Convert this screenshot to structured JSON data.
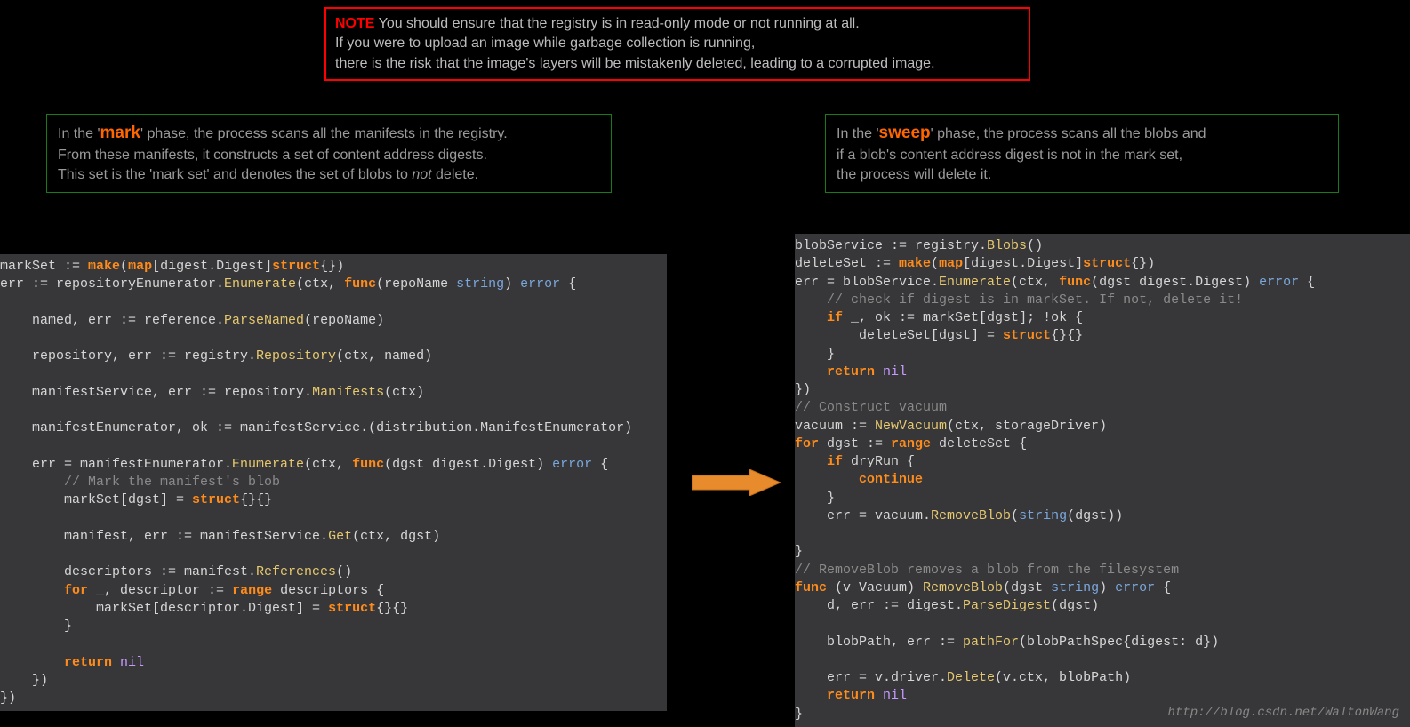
{
  "note": {
    "label": "NOTE",
    "line1_rest": " You should ensure that the registry is in read-only mode or not running at all.",
    "line2": "If you were to upload an image while garbage collection is running,",
    "line3": "there is the risk that the image's layers will be mistakenly deleted, leading to a corrupted image."
  },
  "mark_phase": {
    "pre": "In the '",
    "word": "mark",
    "post": "' phase, the process scans all the manifests in the registry.",
    "line2": "From these manifests, it constructs a set of content address digests.",
    "line3a": "This set is the 'mark set' and denotes the set of blobs to ",
    "line3_not": "not",
    "line3b": " delete."
  },
  "sweep_phase": {
    "pre": "In the '",
    "word": "sweep",
    "post": "' phase, the process scans all the blobs and",
    "line2": "if a blob's content address digest is not in the mark set,",
    "line3": "the process will delete it."
  },
  "code_left": [
    [
      [
        "plain",
        "markSet := "
      ],
      [
        "keyword",
        "make"
      ],
      [
        "plain",
        "("
      ],
      [
        "keyword",
        "map"
      ],
      [
        "plain",
        "[digest.Digest]"
      ],
      [
        "keyword",
        "struct"
      ],
      [
        "plain",
        "{})"
      ]
    ],
    [
      [
        "plain",
        "err := repositoryEnumerator."
      ],
      [
        "func",
        "Enumerate"
      ],
      [
        "plain",
        "(ctx, "
      ],
      [
        "keyword",
        "func"
      ],
      [
        "plain",
        "(repoName "
      ],
      [
        "type",
        "string"
      ],
      [
        "plain",
        ") "
      ],
      [
        "type",
        "error"
      ],
      [
        "plain",
        " {"
      ]
    ],
    [
      [
        "plain",
        ""
      ]
    ],
    [
      [
        "plain",
        "    named, err := reference."
      ],
      [
        "func",
        "ParseNamed"
      ],
      [
        "plain",
        "(repoName)"
      ]
    ],
    [
      [
        "plain",
        ""
      ]
    ],
    [
      [
        "plain",
        "    repository, err := registry."
      ],
      [
        "func",
        "Repository"
      ],
      [
        "plain",
        "(ctx, named)"
      ]
    ],
    [
      [
        "plain",
        ""
      ]
    ],
    [
      [
        "plain",
        "    manifestService, err := repository."
      ],
      [
        "func",
        "Manifests"
      ],
      [
        "plain",
        "(ctx)"
      ]
    ],
    [
      [
        "plain",
        ""
      ]
    ],
    [
      [
        "plain",
        "    manifestEnumerator, ok := manifestService.(distribution.ManifestEnumerator)"
      ]
    ],
    [
      [
        "plain",
        ""
      ]
    ],
    [
      [
        "plain",
        "    err = manifestEnumerator."
      ],
      [
        "func",
        "Enumerate"
      ],
      [
        "plain",
        "(ctx, "
      ],
      [
        "keyword",
        "func"
      ],
      [
        "plain",
        "(dgst digest.Digest) "
      ],
      [
        "type",
        "error"
      ],
      [
        "plain",
        " {"
      ]
    ],
    [
      [
        "plain",
        "        "
      ],
      [
        "comment",
        "// Mark the manifest's blob"
      ]
    ],
    [
      [
        "plain",
        "        markSet[dgst] = "
      ],
      [
        "keyword",
        "struct"
      ],
      [
        "plain",
        "{}{}"
      ]
    ],
    [
      [
        "plain",
        ""
      ]
    ],
    [
      [
        "plain",
        "        manifest, err := manifestService."
      ],
      [
        "func",
        "Get"
      ],
      [
        "plain",
        "(ctx, dgst)"
      ]
    ],
    [
      [
        "plain",
        ""
      ]
    ],
    [
      [
        "plain",
        "        descriptors := manifest."
      ],
      [
        "func",
        "References"
      ],
      [
        "plain",
        "()"
      ]
    ],
    [
      [
        "plain",
        "        "
      ],
      [
        "keyword",
        "for"
      ],
      [
        "plain",
        " _, descriptor := "
      ],
      [
        "keyword",
        "range"
      ],
      [
        "plain",
        " descriptors {"
      ]
    ],
    [
      [
        "plain",
        "            markSet[descriptor.Digest] = "
      ],
      [
        "keyword",
        "struct"
      ],
      [
        "plain",
        "{}{}"
      ]
    ],
    [
      [
        "plain",
        "        }"
      ]
    ],
    [
      [
        "plain",
        ""
      ]
    ],
    [
      [
        "plain",
        "        "
      ],
      [
        "keyword",
        "return"
      ],
      [
        "plain",
        " "
      ],
      [
        "nil",
        "nil"
      ]
    ],
    [
      [
        "plain",
        "    })"
      ]
    ],
    [
      [
        "plain",
        "})"
      ]
    ]
  ],
  "code_right": [
    [
      [
        "plain",
        "blobService := registry."
      ],
      [
        "func",
        "Blobs"
      ],
      [
        "plain",
        "()"
      ]
    ],
    [
      [
        "plain",
        "deleteSet := "
      ],
      [
        "keyword",
        "make"
      ],
      [
        "plain",
        "("
      ],
      [
        "keyword",
        "map"
      ],
      [
        "plain",
        "[digest.Digest]"
      ],
      [
        "keyword",
        "struct"
      ],
      [
        "plain",
        "{})"
      ]
    ],
    [
      [
        "plain",
        "err = blobService."
      ],
      [
        "func",
        "Enumerate"
      ],
      [
        "plain",
        "(ctx, "
      ],
      [
        "keyword",
        "func"
      ],
      [
        "plain",
        "(dgst digest.Digest) "
      ],
      [
        "type",
        "error"
      ],
      [
        "plain",
        " {"
      ]
    ],
    [
      [
        "plain",
        "    "
      ],
      [
        "comment",
        "// check if digest is in markSet. If not, delete it!"
      ]
    ],
    [
      [
        "plain",
        "    "
      ],
      [
        "keyword",
        "if"
      ],
      [
        "plain",
        " _, ok := markSet[dgst]; !ok {"
      ]
    ],
    [
      [
        "plain",
        "        deleteSet[dgst] = "
      ],
      [
        "keyword",
        "struct"
      ],
      [
        "plain",
        "{}{}"
      ]
    ],
    [
      [
        "plain",
        "    }"
      ]
    ],
    [
      [
        "plain",
        "    "
      ],
      [
        "keyword",
        "return"
      ],
      [
        "plain",
        " "
      ],
      [
        "nil",
        "nil"
      ]
    ],
    [
      [
        "plain",
        "})"
      ]
    ],
    [
      [
        "comment",
        "// Construct vacuum"
      ]
    ],
    [
      [
        "plain",
        "vacuum := "
      ],
      [
        "func",
        "NewVacuum"
      ],
      [
        "plain",
        "(ctx, storageDriver)"
      ]
    ],
    [
      [
        "keyword",
        "for"
      ],
      [
        "plain",
        " dgst := "
      ],
      [
        "keyword",
        "range"
      ],
      [
        "plain",
        " deleteSet {"
      ]
    ],
    [
      [
        "plain",
        "    "
      ],
      [
        "keyword",
        "if"
      ],
      [
        "plain",
        " dryRun {"
      ]
    ],
    [
      [
        "plain",
        "        "
      ],
      [
        "keyword",
        "continue"
      ]
    ],
    [
      [
        "plain",
        "    }"
      ]
    ],
    [
      [
        "plain",
        "    err = vacuum."
      ],
      [
        "func",
        "RemoveBlob"
      ],
      [
        "plain",
        "("
      ],
      [
        "type",
        "string"
      ],
      [
        "plain",
        "(dgst))"
      ]
    ],
    [
      [
        "plain",
        ""
      ]
    ],
    [
      [
        "plain",
        "}"
      ]
    ],
    [
      [
        "comment",
        "// RemoveBlob removes a blob from the filesystem"
      ]
    ],
    [
      [
        "keyword",
        "func"
      ],
      [
        "plain",
        " (v Vacuum) "
      ],
      [
        "func",
        "RemoveBlob"
      ],
      [
        "plain",
        "(dgst "
      ],
      [
        "type",
        "string"
      ],
      [
        "plain",
        ") "
      ],
      [
        "type",
        "error"
      ],
      [
        "plain",
        " {"
      ]
    ],
    [
      [
        "plain",
        "    d, err := digest."
      ],
      [
        "func",
        "ParseDigest"
      ],
      [
        "plain",
        "(dgst)"
      ]
    ],
    [
      [
        "plain",
        ""
      ]
    ],
    [
      [
        "plain",
        "    blobPath, err := "
      ],
      [
        "func",
        "pathFor"
      ],
      [
        "plain",
        "(blobPathSpec{digest: d})"
      ]
    ],
    [
      [
        "plain",
        ""
      ]
    ],
    [
      [
        "plain",
        "    err = v.driver."
      ],
      [
        "func",
        "Delete"
      ],
      [
        "plain",
        "(v.ctx, blobPath)"
      ]
    ],
    [
      [
        "plain",
        "    "
      ],
      [
        "keyword",
        "return"
      ],
      [
        "plain",
        " "
      ],
      [
        "nil",
        "nil"
      ]
    ],
    [
      [
        "plain",
        "}"
      ]
    ]
  ],
  "watermark": "http://blog.csdn.net/WaltonWang"
}
